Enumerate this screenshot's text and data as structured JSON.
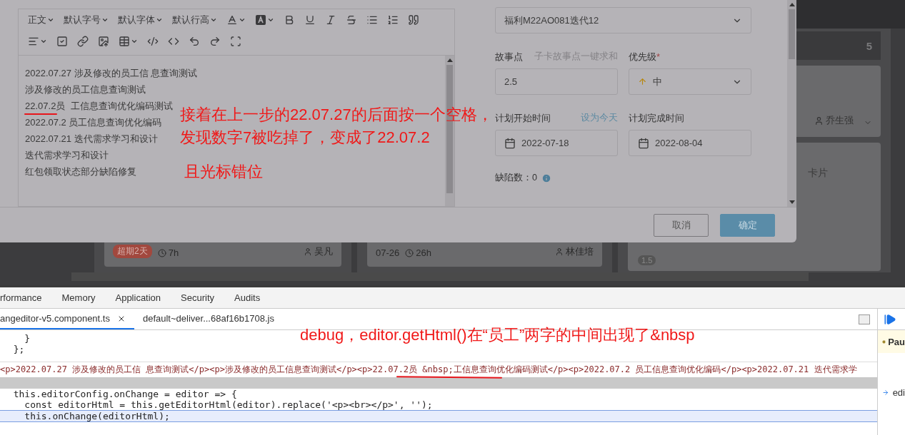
{
  "board": {
    "cards": [
      {
        "kind": "overdue",
        "badge": "超期2天",
        "hours": "7h",
        "assignee": "吴凡"
      },
      {
        "kind": "dated",
        "date": "07-26",
        "hours": "26h",
        "assignee": "林佳培"
      }
    ],
    "right_column": {
      "count": "5",
      "assignee": "乔生强",
      "add_card": "卡片",
      "points": "1.5"
    }
  },
  "modal": {
    "editor": {
      "dropdowns": [
        "正文",
        "默认字号",
        "默认字体",
        "默认行高"
      ],
      "lines": [
        {
          "text": "2022.07.27 涉及修改的员工信 息查询测试",
          "underlined": false
        },
        {
          "text": "涉及修改的员工信息查询测试",
          "underlined": false
        },
        {
          "text": "22.07.2员  工信息查询优化编码测试",
          "underlined": true
        },
        {
          "text": "2022.07.2 员工信息查询优化编码",
          "underlined": false
        },
        {
          "text": "2022.07.21 迭代需求学习和设计",
          "underlined": false
        },
        {
          "text": "迭代需求学习和设计",
          "underlined": false
        },
        {
          "text": "红包领取状态部分缺陷修复",
          "underlined": false
        }
      ]
    },
    "form": {
      "iteration": "福利M22AO081迭代12",
      "story_points": {
        "label": "故事点",
        "link": "子卡故事点一键求和",
        "value": "2.5"
      },
      "priority": {
        "label": "优先级",
        "required_mark": "*",
        "value": "中"
      },
      "start": {
        "label": "计划开始时间",
        "link": "设为今天",
        "value": "2022-07-18"
      },
      "end": {
        "label": "计划完成时间",
        "value": "2022-08-04"
      },
      "defects": "缺陷数：0"
    },
    "buttons": [
      {
        "label": "取消",
        "kind": "secondary"
      },
      {
        "label": "确定",
        "kind": "primary"
      }
    ]
  },
  "devtools": {
    "panel_tabs": [
      "rformance",
      "Memory",
      "Application",
      "Security",
      "Audits"
    ],
    "file_tabs": [
      {
        "label": "angeditor-v5.component.ts",
        "selected": true,
        "closable": true
      },
      {
        "label": "default~deliver...68af16b1708.js",
        "selected": false,
        "closable": false
      }
    ],
    "code_top": [
      "    }",
      "  };"
    ],
    "tooltip": {
      "text": "<p>2022.07.27 涉及修改的员工信 息查询测试</p><p>涉及修改的员工信息查询测试</p><p>22.07.2员 &nbsp;工信息查询优化编码测试</p><p>2022.07.2 员工信息查询优化编码</p><p>2022.07.21 迭代需求学",
      "underlined": true
    },
    "code_lines": [
      {
        "text": "  this.editorConfig.onChange = editor => {",
        "current": false
      },
      {
        "text": "    const editorHtml = this.getEditorHtml(editor).replace('<p><br></p>', '');",
        "current": false
      },
      {
        "text": "    this.onChange(editorHtml);",
        "current": true
      }
    ],
    "sidebar": {
      "status": "Pau",
      "scope_item": "edi"
    }
  },
  "annotations": {
    "editor_note": [
      "接着在上一步的22.07.27的后面按一个空格，",
      "发现数字7被吃掉了，变成了22.07.2",
      "且光标错位"
    ],
    "debug_note": "debug，editor.getHtml()在“员工”两字的中间出现了&nbsp"
  }
}
